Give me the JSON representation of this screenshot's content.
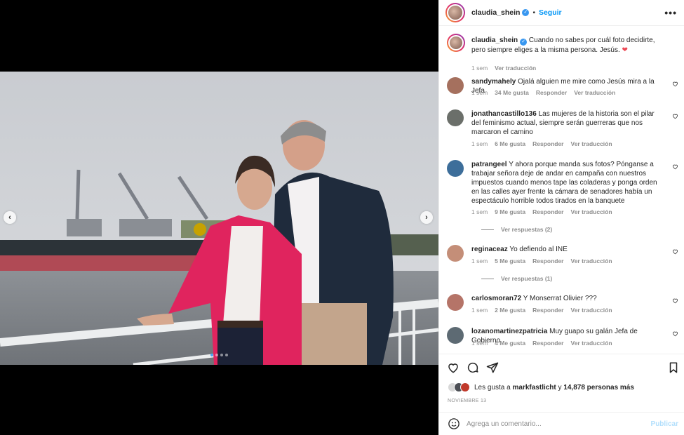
{
  "post": {
    "username": "claudia_shein",
    "follow_label": "Seguir",
    "more_label": "•••",
    "carousel": {
      "slides": 4,
      "active": 1
    }
  },
  "caption": {
    "username": "claudia_shein",
    "text": "Cuando no sabes por cuál foto decidirte, pero siempre eliges a la misma persona. Jesús.",
    "emoji": "❤",
    "time": "1 sem",
    "translate": "Ver traducción"
  },
  "comments": [
    {
      "username": "sandymahely",
      "text": "Ojalá alguien me mire como Jesús mira a la Jefa",
      "time": "1 sem",
      "likes": "34 Me gusta",
      "reply": "Responder",
      "translate": "Ver traducción"
    },
    {
      "username": "jonathancastillo136",
      "text": "Las mujeres de la historia son el pilar del feminismo actual, siempre serán guerreras que nos marcaron el camino",
      "time": "1 sem",
      "likes": "6 Me gusta",
      "reply": "Responder",
      "translate": "Ver traducción"
    },
    {
      "username": "patrangeel",
      "text": "Y ahora porque manda sus fotos? Pónganse a trabajar señora deje de andar en campaña con nuestros impuestos cuando menos tape las coladeras y ponga orden en las calles ayer frente la cámara de senadores había un espectáculo horrible todos tirados en la banquete",
      "time": "1 sem",
      "likes": "9 Me gusta",
      "reply": "Responder",
      "translate": "Ver traducción",
      "replies": "Ver respuestas (2)"
    },
    {
      "username": "reginaceaz",
      "text": "Yo defiendo al INE",
      "time": "1 sem",
      "likes": "5 Me gusta",
      "reply": "Responder",
      "translate": "Ver traducción",
      "replies": "Ver respuestas (1)"
    },
    {
      "username": "carlosmoran72",
      "text": "Y Monserrat Olivier ???",
      "time": "1 sem",
      "likes": "2 Me gusta",
      "reply": "Responder",
      "translate": "Ver traducción"
    },
    {
      "username": "lozanomartinezpatricia",
      "text": "Muy guapo su galán Jefa de Gobierno",
      "time": "1 sem",
      "likes": "4 Me gusta",
      "reply": "Responder",
      "translate": "Ver traducción"
    }
  ],
  "likes": {
    "prefix": "Les gusta a",
    "user": "markfastlicht",
    "middle": "y",
    "count": "14,878 personas más"
  },
  "date": "NOVIEMBRE 13",
  "add_comment": {
    "placeholder": "Agrega un comentario...",
    "publish": "Publicar"
  },
  "colors": {
    "accent": "#0095f6",
    "like_red": "#ed4956",
    "muted": "#8e8e8e",
    "jacket_pink": "#e0245e"
  },
  "icons": [
    "heart-icon",
    "comment-icon",
    "share-icon",
    "bookmark-icon",
    "emoji-icon",
    "verified-icon",
    "chevron-left-icon",
    "chevron-right-icon"
  ]
}
